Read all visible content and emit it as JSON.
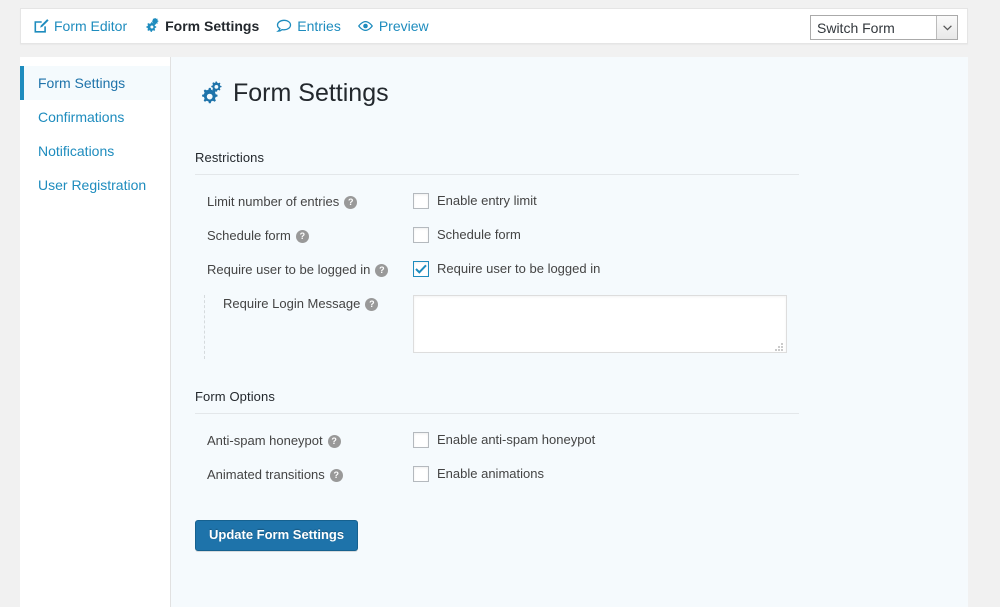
{
  "toolbar": {
    "nav": [
      {
        "label": "Form Editor",
        "icon": "edit-pencil-square-icon",
        "active": false
      },
      {
        "label": "Form Settings",
        "icon": "gears-icon",
        "active": true
      },
      {
        "label": "Entries",
        "icon": "speech-bubble-icon",
        "active": false
      },
      {
        "label": "Preview",
        "icon": "eye-icon",
        "active": false
      }
    ],
    "switch_form": {
      "value": "Switch Form",
      "icon": "chevron-down-icon"
    }
  },
  "sidebar": {
    "items": [
      {
        "label": "Form Settings",
        "active": true
      },
      {
        "label": "Confirmations",
        "active": false
      },
      {
        "label": "Notifications",
        "active": false
      },
      {
        "label": "User Registration",
        "active": false
      }
    ]
  },
  "main": {
    "title": "Form Settings",
    "title_icon": "gears-icon",
    "sections": {
      "restrictions": {
        "title": "Restrictions",
        "rows": [
          {
            "label": "Limit number of entries",
            "help": "?",
            "checkbox_label": "Enable entry limit",
            "checked": false
          },
          {
            "label": "Schedule form",
            "help": "?",
            "checkbox_label": "Schedule form",
            "checked": false
          },
          {
            "label": "Require user to be logged in",
            "help": "?",
            "checkbox_label": "Require user to be logged in",
            "checked": true
          }
        ],
        "subrow": {
          "label": "Require Login Message",
          "help": "?",
          "textarea_value": "",
          "textarea_placeholder": ""
        }
      },
      "form_options": {
        "title": "Form Options",
        "rows": [
          {
            "label": "Anti-spam honeypot",
            "help": "?",
            "checkbox_label": "Enable anti-spam honeypot",
            "checked": false
          },
          {
            "label": "Animated transitions",
            "help": "?",
            "checkbox_label": "Enable animations",
            "checked": false
          }
        ]
      }
    },
    "submit_label": "Update Form Settings"
  },
  "colors": {
    "accent": "#1e8cbe",
    "button": "#1e73aa",
    "panel_bg": "#f5fafd",
    "page_bg": "#f1f1f1"
  }
}
